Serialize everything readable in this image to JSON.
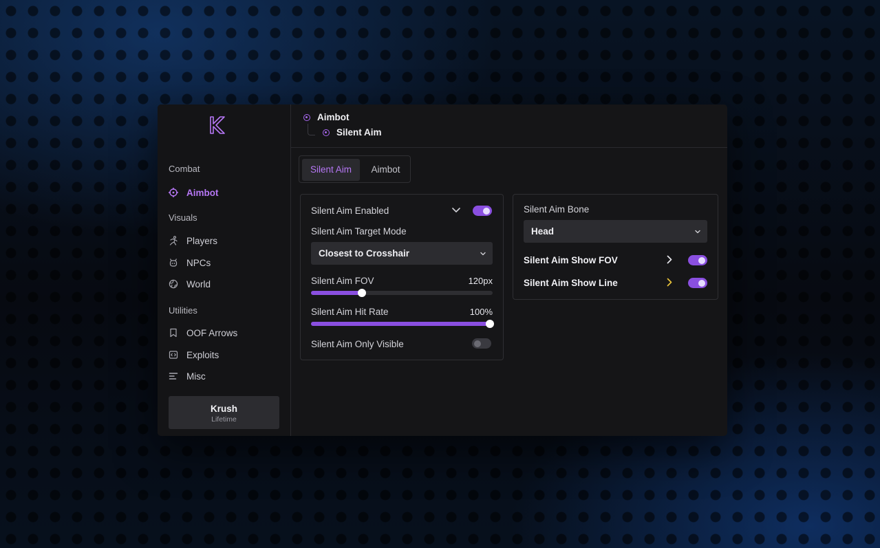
{
  "sidebar": {
    "sections": [
      {
        "label": "Combat",
        "items": [
          {
            "label": "Aimbot",
            "icon": "crosshair-icon",
            "active": true
          }
        ]
      },
      {
        "label": "Visuals",
        "items": [
          {
            "label": "Players",
            "icon": "running-person-icon"
          },
          {
            "label": "NPCs",
            "icon": "robot-icon"
          },
          {
            "label": "World",
            "icon": "globe-icon"
          }
        ]
      },
      {
        "label": "Utilities",
        "items": [
          {
            "label": "OOF Arrows",
            "icon": "bookmark-icon"
          },
          {
            "label": "Exploits",
            "icon": "code-icon"
          },
          {
            "label": "Misc",
            "icon": "list-icon"
          }
        ]
      }
    ],
    "user": {
      "name": "Krush",
      "plan": "Lifetime"
    }
  },
  "breadcrumb": {
    "parent": "Aimbot",
    "child": "Silent Aim"
  },
  "tabs": [
    {
      "label": "Silent Aim",
      "active": true
    },
    {
      "label": "Aimbot",
      "active": false
    }
  ],
  "left_panel": {
    "enabled_label": "Silent Aim Enabled",
    "enabled": true,
    "target_mode_label": "Silent Aim Target Mode",
    "target_mode_value": "Closest to Crosshair",
    "fov_label": "Silent Aim FOV",
    "fov_value": "120px",
    "fov_fraction": 0.28,
    "hit_rate_label": "Silent Aim Hit Rate",
    "hit_rate_value": "100%",
    "hit_rate_fraction": 1.0,
    "only_visible_label": "Silent Aim Only Visible",
    "only_visible": false
  },
  "right_panel": {
    "bone_label": "Silent Aim Bone",
    "bone_value": "Head",
    "show_fov_label": "Silent Aim Show FOV",
    "show_fov": true,
    "show_line_label": "Silent Aim Show Line",
    "show_line": true
  },
  "colors": {
    "accent": "#a968f0",
    "toggle_on": "#8a4fe0",
    "line_chevron": "#e8c23a"
  }
}
